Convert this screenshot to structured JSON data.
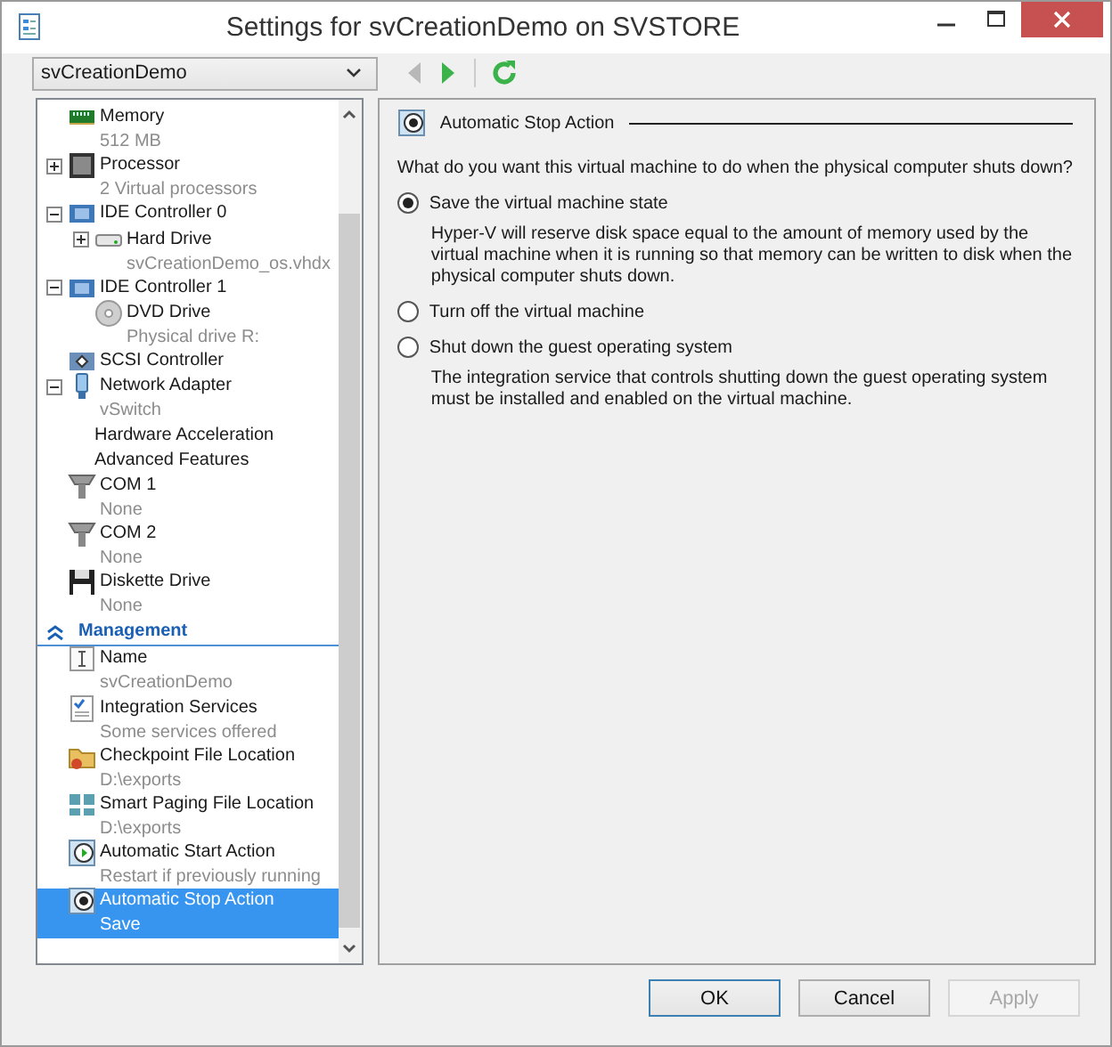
{
  "window": {
    "title": "Settings for svCreationDemo on SVSTORE"
  },
  "toolbar": {
    "vm_select": {
      "value": "svCreationDemo"
    },
    "buttons": [
      {
        "kind": "back",
        "disabled": true
      },
      {
        "kind": "forward",
        "disabled": false
      },
      {
        "kind": "refresh",
        "disabled": false
      }
    ]
  },
  "tree": {
    "items": [
      {
        "kind": "memory",
        "label": "Memory",
        "detail": "512 MB",
        "selected": false
      },
      {
        "kind": "processor",
        "label": "Processor",
        "detail": "2 Virtual processors",
        "expanded": false,
        "selected": false
      },
      {
        "kind": "controller",
        "label": "IDE Controller 0",
        "expanded": true,
        "selected": false,
        "children": [
          {
            "kind": "disk",
            "label": "Hard Drive",
            "detail": "svCreationDemo_os.vhdx",
            "expanded": false,
            "selected": false
          }
        ]
      },
      {
        "kind": "controller",
        "label": "IDE Controller 1",
        "expanded": true,
        "selected": false,
        "children": [
          {
            "kind": "dvd",
            "label": "DVD Drive",
            "detail": "Physical drive R:",
            "selected": false
          }
        ]
      },
      {
        "kind": "scsi",
        "label": "SCSI Controller",
        "selected": false
      },
      {
        "kind": "network",
        "label": "Network Adapter",
        "detail": "vSwitch",
        "expanded": true,
        "selected": false,
        "children": [
          {
            "kind": "plain",
            "label": "Hardware Acceleration",
            "selected": false
          },
          {
            "kind": "plain",
            "label": "Advanced Features",
            "selected": false
          }
        ]
      },
      {
        "kind": "port",
        "label": "COM 1",
        "detail": "None",
        "selected": false
      },
      {
        "kind": "port",
        "label": "COM 2",
        "detail": "None",
        "selected": false
      },
      {
        "kind": "floppy",
        "label": "Diskette Drive",
        "detail": "None",
        "selected": false
      },
      {
        "kind": "section",
        "label": "Management",
        "expanded": true,
        "children": [
          {
            "kind": "name",
            "label": "Name",
            "detail": "svCreationDemo",
            "selected": false
          },
          {
            "kind": "services",
            "label": "Integration Services",
            "detail": "Some services offered",
            "selected": false
          },
          {
            "kind": "folder",
            "label": "Checkpoint File Location",
            "detail": "D:\\exports",
            "selected": false
          },
          {
            "kind": "paging",
            "label": "Smart Paging File Location",
            "detail": "D:\\exports",
            "selected": false
          },
          {
            "kind": "start",
            "label": "Automatic Start Action",
            "detail": "Restart if previously running",
            "selected": false
          },
          {
            "kind": "stop",
            "label": "Automatic Stop Action",
            "detail": "Save",
            "selected": true
          }
        ]
      }
    ]
  },
  "pane": {
    "title": "Automatic Stop Action",
    "question": "What do you want this virtual machine to do when the physical computer shuts down?",
    "options": [
      {
        "label": "Save the virtual machine state",
        "selected": true,
        "note": "Hyper-V will reserve disk space equal to the amount of memory used by the virtual machine when it is running so that memory can be written to disk when the physical computer shuts down."
      },
      {
        "label": "Turn off the virtual machine",
        "selected": false
      },
      {
        "label": "Shut down the guest operating system",
        "selected": false,
        "note": "The integration service that controls shutting down the guest operating system must be installed and enabled on the virtual machine."
      }
    ]
  },
  "buttons": [
    {
      "label": "OK",
      "default": true,
      "disabled": false
    },
    {
      "label": "Cancel",
      "default": false,
      "disabled": false
    },
    {
      "label": "Apply",
      "default": false,
      "disabled": true
    }
  ]
}
